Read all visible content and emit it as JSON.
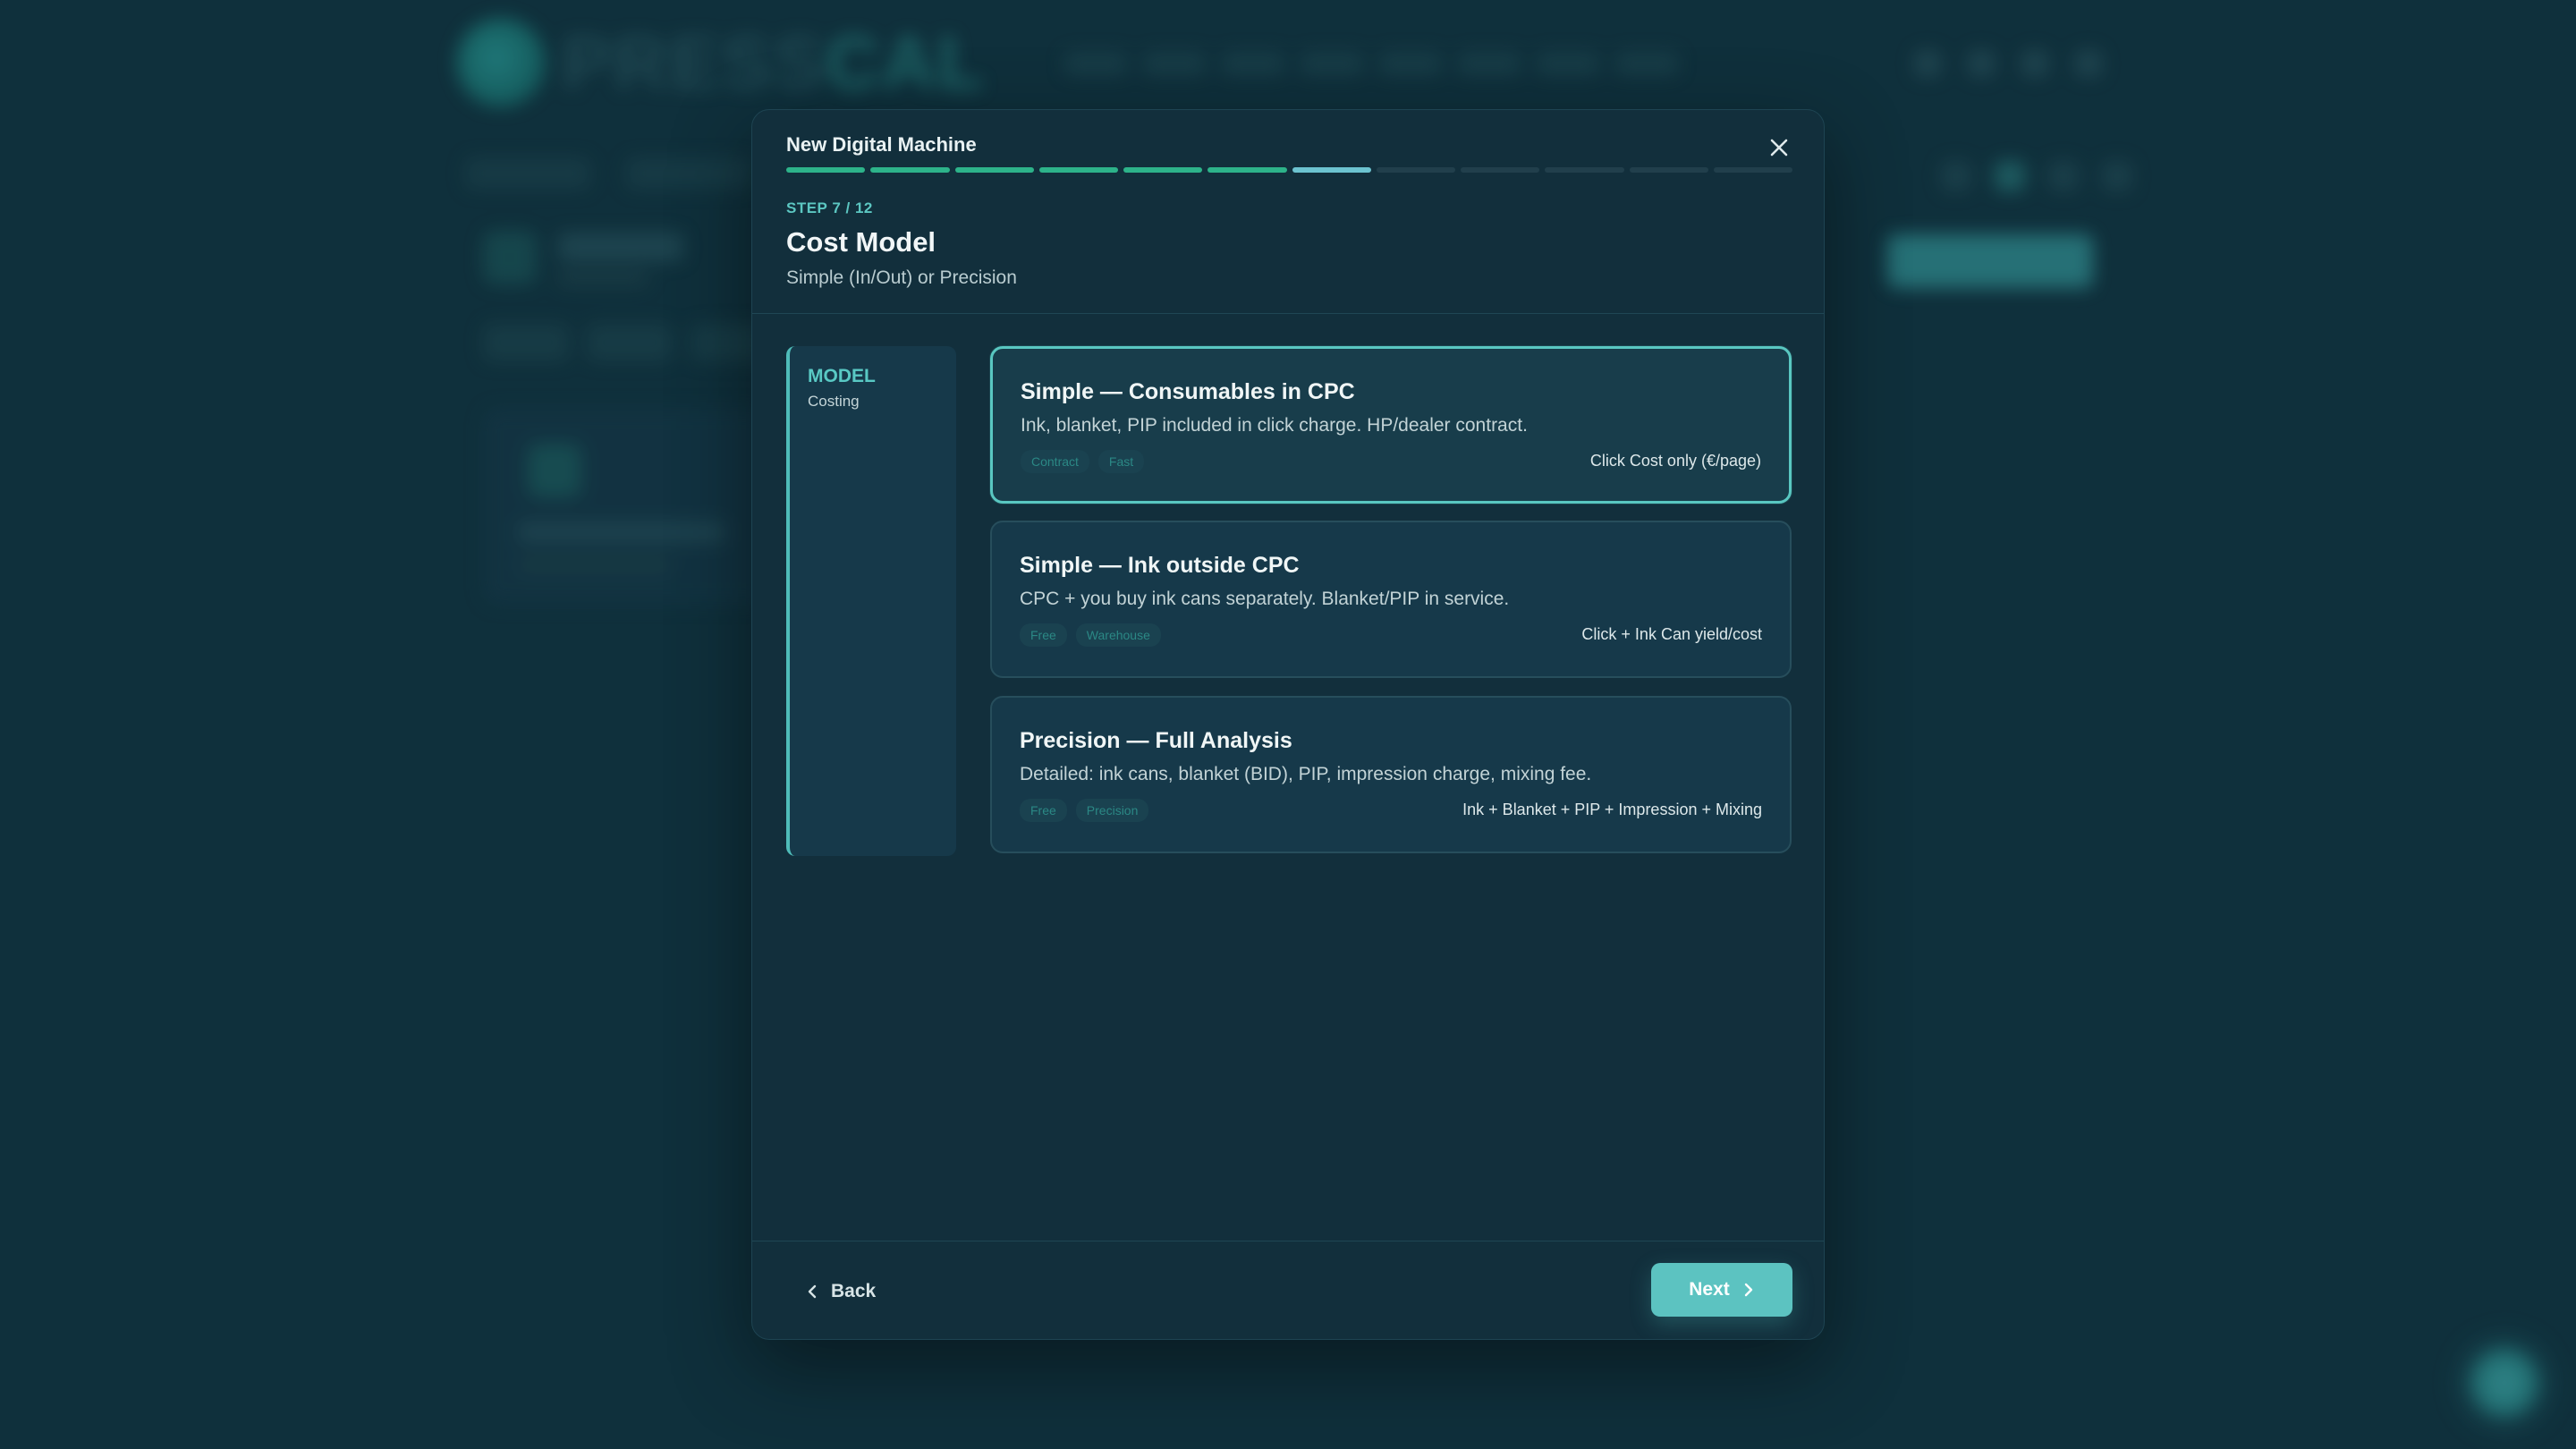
{
  "modal": {
    "title": "New Digital Machine",
    "progress": {
      "current": 7,
      "total": 12
    },
    "step_label": "STEP 7 / 12",
    "page_title": "Cost Model",
    "page_subtitle": "Simple (In/Out) or Precision"
  },
  "sidebar": {
    "title": "MODEL",
    "subtitle": "Costing"
  },
  "options": [
    {
      "title": "Simple — Consumables in CPC",
      "description": "Ink, blanket, PIP included in click charge. HP/dealer contract.",
      "tags": [
        "Contract",
        "Fast"
      ],
      "meta": "Click Cost only (€/page)",
      "selected": true
    },
    {
      "title": "Simple — Ink outside CPC",
      "description": "CPC + you buy ink cans separately. Blanket/PIP in service.",
      "tags": [
        "Free",
        "Warehouse"
      ],
      "meta": "Click + Ink Can yield/cost",
      "selected": false
    },
    {
      "title": "Precision — Full Analysis",
      "description": "Detailed: ink cans, blanket (BID), PIP, impression charge, mixing fee.",
      "tags": [
        "Free",
        "Precision"
      ],
      "meta": "Ink + Blanket + PIP + Impression + Mixing",
      "selected": false
    }
  ],
  "footer": {
    "back_label": "Back",
    "next_label": "Next"
  },
  "colors": {
    "accent": "#5cc3c1",
    "progress_done": "#2db38a",
    "progress_current": "#6cc3d0",
    "background": "#113340",
    "modal": "#122f3c"
  },
  "icons": {
    "close": "close-icon",
    "back": "chevron-left-icon",
    "next": "chevron-right-icon"
  }
}
